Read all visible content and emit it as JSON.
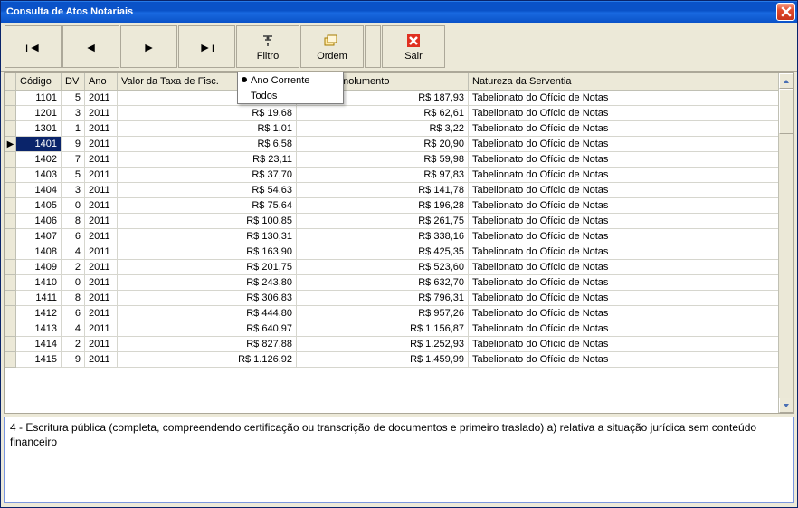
{
  "window": {
    "title": "Consulta de Atos Notariais"
  },
  "toolbar": {
    "filtro": "Filtro",
    "ordem": "Ordem",
    "sair": "Sair"
  },
  "filtro_menu": {
    "ano_corrente": "Ano Corrente",
    "todos": "Todos"
  },
  "columns": {
    "codigo": "Código",
    "dv": "DV",
    "ano": "Ano",
    "taxa": "Valor da Taxa de Fisc.",
    "emolumento": "alor do Emolumento",
    "natureza": "Natureza da Serventia"
  },
  "selected_index": 3,
  "rows": [
    {
      "codigo": "1101",
      "dv": "5",
      "ano": "2011",
      "taxa": "",
      "emol": "R$ 187,93",
      "nat": "Tabelionato do Ofício de Notas"
    },
    {
      "codigo": "1201",
      "dv": "3",
      "ano": "2011",
      "taxa": "R$ 19,68",
      "emol": "R$ 62,61",
      "nat": "Tabelionato do Ofício de Notas"
    },
    {
      "codigo": "1301",
      "dv": "1",
      "ano": "2011",
      "taxa": "R$ 1,01",
      "emol": "R$ 3,22",
      "nat": "Tabelionato do Ofício de Notas"
    },
    {
      "codigo": "1401",
      "dv": "9",
      "ano": "2011",
      "taxa": "R$ 6,58",
      "emol": "R$ 20,90",
      "nat": "Tabelionato do Ofício de Notas"
    },
    {
      "codigo": "1402",
      "dv": "7",
      "ano": "2011",
      "taxa": "R$ 23,11",
      "emol": "R$ 59,98",
      "nat": "Tabelionato do Ofício de Notas"
    },
    {
      "codigo": "1403",
      "dv": "5",
      "ano": "2011",
      "taxa": "R$ 37,70",
      "emol": "R$ 97,83",
      "nat": "Tabelionato do Ofício de Notas"
    },
    {
      "codigo": "1404",
      "dv": "3",
      "ano": "2011",
      "taxa": "R$ 54,63",
      "emol": "R$ 141,78",
      "nat": "Tabelionato do Ofício de Notas"
    },
    {
      "codigo": "1405",
      "dv": "0",
      "ano": "2011",
      "taxa": "R$ 75,64",
      "emol": "R$ 196,28",
      "nat": "Tabelionato do Ofício de Notas"
    },
    {
      "codigo": "1406",
      "dv": "8",
      "ano": "2011",
      "taxa": "R$ 100,85",
      "emol": "R$ 261,75",
      "nat": "Tabelionato do Ofício de Notas"
    },
    {
      "codigo": "1407",
      "dv": "6",
      "ano": "2011",
      "taxa": "R$ 130,31",
      "emol": "R$ 338,16",
      "nat": "Tabelionato do Ofício de Notas"
    },
    {
      "codigo": "1408",
      "dv": "4",
      "ano": "2011",
      "taxa": "R$ 163,90",
      "emol": "R$ 425,35",
      "nat": "Tabelionato do Ofício de Notas"
    },
    {
      "codigo": "1409",
      "dv": "2",
      "ano": "2011",
      "taxa": "R$ 201,75",
      "emol": "R$ 523,60",
      "nat": "Tabelionato do Ofício de Notas"
    },
    {
      "codigo": "1410",
      "dv": "0",
      "ano": "2011",
      "taxa": "R$ 243,80",
      "emol": "R$ 632,70",
      "nat": "Tabelionato do Ofício de Notas"
    },
    {
      "codigo": "1411",
      "dv": "8",
      "ano": "2011",
      "taxa": "R$ 306,83",
      "emol": "R$ 796,31",
      "nat": "Tabelionato do Ofício de Notas"
    },
    {
      "codigo": "1412",
      "dv": "6",
      "ano": "2011",
      "taxa": "R$ 444,80",
      "emol": "R$ 957,26",
      "nat": "Tabelionato do Ofício de Notas"
    },
    {
      "codigo": "1413",
      "dv": "4",
      "ano": "2011",
      "taxa": "R$ 640,97",
      "emol": "R$ 1.156,87",
      "nat": "Tabelionato do Ofício de Notas"
    },
    {
      "codigo": "1414",
      "dv": "2",
      "ano": "2011",
      "taxa": "R$ 827,88",
      "emol": "R$ 1.252,93",
      "nat": "Tabelionato do Ofício de Notas"
    },
    {
      "codigo": "1415",
      "dv": "9",
      "ano": "2011",
      "taxa": "R$ 1.126,92",
      "emol": "R$ 1.459,99",
      "nat": "Tabelionato do Ofício de Notas"
    }
  ],
  "detail": "4 - Escritura pública (completa, compreendendo certificação ou transcrição de documentos e primeiro traslado) a) relativa a situação jurídica sem conteúdo financeiro"
}
